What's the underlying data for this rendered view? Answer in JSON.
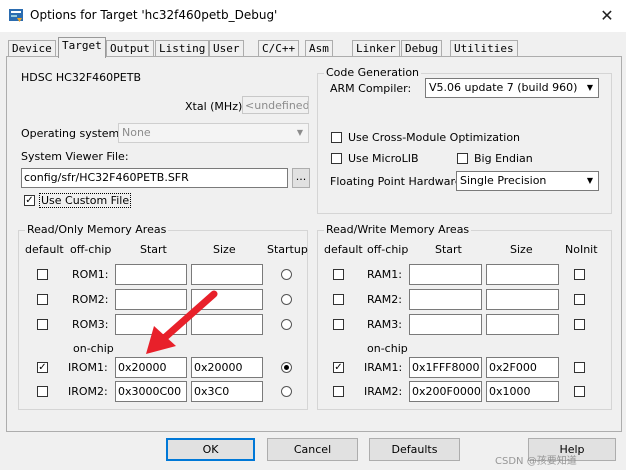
{
  "window": {
    "title": "Options for Target 'hc32f460petb_Debug'",
    "close_glyph": "✕"
  },
  "tabs": [
    {
      "label": "Device",
      "active": false
    },
    {
      "label": "Target",
      "active": true
    },
    {
      "label": "Output",
      "active": false
    },
    {
      "label": "Listing",
      "active": false
    },
    {
      "label": "User",
      "active": false
    },
    {
      "label": "C/C++",
      "active": false
    },
    {
      "label": "Asm",
      "active": false
    },
    {
      "label": "Linker",
      "active": false
    },
    {
      "label": "Debug",
      "active": false
    },
    {
      "label": "Utilities",
      "active": false
    }
  ],
  "device_name": "HDSC HC32F460PETB",
  "xtal": {
    "label": "Xtal (MHz):",
    "value": "<undefined>"
  },
  "operating_system": {
    "label": "Operating system:",
    "value": "None"
  },
  "system_viewer": {
    "label": "System Viewer File:",
    "value": "config/sfr/HC32F460PETB.SFR",
    "browse": "..."
  },
  "use_custom_file": {
    "label": "Use Custom File",
    "checked": true
  },
  "code_generation": {
    "title": "Code Generation",
    "arm_compiler_label": "ARM Compiler:",
    "arm_compiler_value": "V5.06 update 7 (build 960)",
    "cross_module_label": "Use Cross-Module Optimization",
    "microlib_label": "Use MicroLIB",
    "big_endian_label": "Big Endian",
    "fpu_label": "Floating Point Hardware:",
    "fpu_value": "Single Precision"
  },
  "ro_memory": {
    "title": "Read/Only Memory Areas",
    "headers": {
      "default": "default",
      "offchip": "off-chip",
      "start": "Start",
      "size": "Size",
      "startup": "Startup"
    },
    "onchip_label": "on-chip",
    "rows": [
      {
        "name": "ROM1:",
        "default": false,
        "start": "",
        "size": "",
        "startup": false
      },
      {
        "name": "ROM2:",
        "default": false,
        "start": "",
        "size": "",
        "startup": false
      },
      {
        "name": "ROM3:",
        "default": false,
        "start": "",
        "size": "",
        "startup": false
      },
      {
        "name": "IROM1:",
        "default": true,
        "start": "0x20000",
        "size": "0x20000",
        "startup": true
      },
      {
        "name": "IROM2:",
        "default": false,
        "start": "0x3000C00",
        "size": "0x3C0",
        "startup": false
      }
    ]
  },
  "rw_memory": {
    "title": "Read/Write Memory Areas",
    "headers": {
      "default": "default",
      "offchip": "off-chip",
      "start": "Start",
      "size": "Size",
      "noinit": "NoInit"
    },
    "onchip_label": "on-chip",
    "rows": [
      {
        "name": "RAM1:",
        "default": false,
        "start": "",
        "size": "",
        "noinit": false
      },
      {
        "name": "RAM2:",
        "default": false,
        "start": "",
        "size": "",
        "noinit": false
      },
      {
        "name": "RAM3:",
        "default": false,
        "start": "",
        "size": "",
        "noinit": false
      },
      {
        "name": "IRAM1:",
        "default": true,
        "start": "0x1FFF8000",
        "size": "0x2F000",
        "noinit": false
      },
      {
        "name": "IRAM2:",
        "default": false,
        "start": "0x200F0000",
        "size": "0x1000",
        "noinit": false
      }
    ]
  },
  "buttons": {
    "ok": "OK",
    "cancel": "Cancel",
    "defaults": "Defaults",
    "help": "Help"
  },
  "watermark": "CSDN @孩要知道",
  "accent_colors": {
    "arrow": "#e8202a",
    "focus": "#0078d7"
  }
}
